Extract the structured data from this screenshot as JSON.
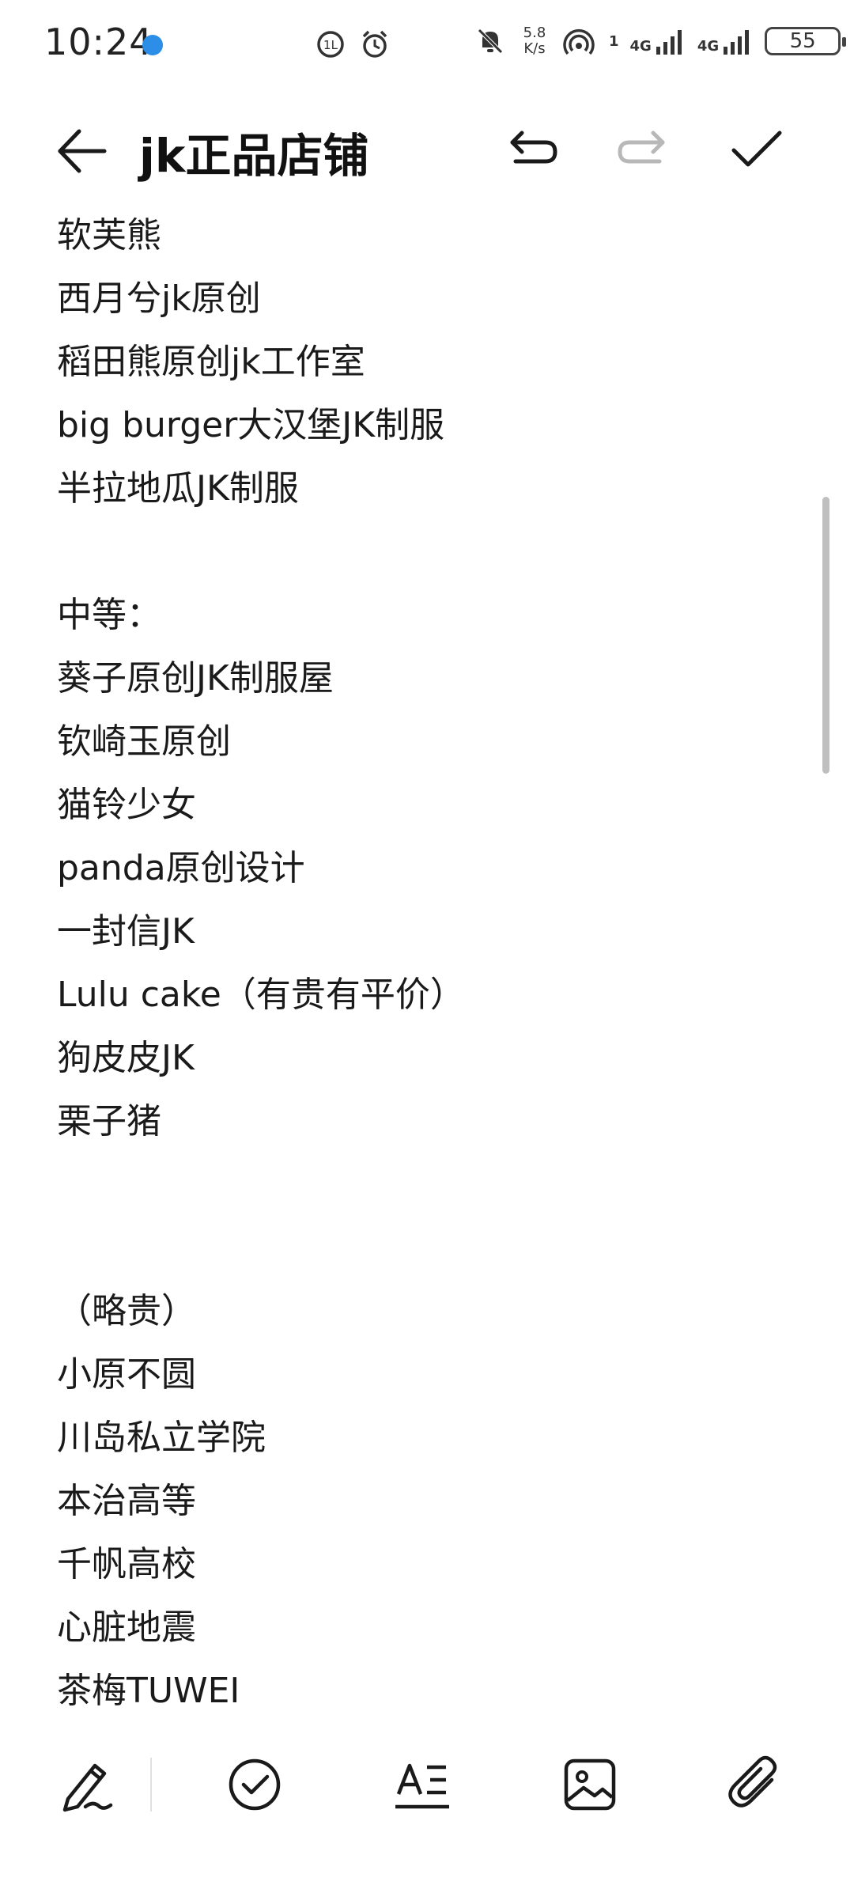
{
  "status_bar": {
    "time": "10:24",
    "net_speed_value": "5.8",
    "net_speed_unit": "K/s",
    "net_superscript": "1",
    "signal1_label": "4G",
    "signal2_label": "4G",
    "battery": "55"
  },
  "toolbar": {
    "title": "jk正品店铺"
  },
  "note": {
    "lines": [
      "软芙熊",
      "西月兮jk原创",
      "稻田熊原创jk工作室",
      "big burger大汉堡JK制服",
      "半拉地瓜JK制服",
      "",
      "中等：",
      "葵子原创JK制服屋",
      "钦崎玉原创",
      "猫铃少女",
      "panda原创设计",
      "一封信JK",
      "Lulu cake（有贵有平价）",
      "狗皮皮JK",
      "栗子猪",
      "",
      "",
      "（略贵）",
      "小原不圆",
      "川岛私立学院",
      "本治高等",
      "千帆高校",
      "心脏地震",
      "茶梅TUWEI"
    ]
  },
  "colors": {
    "icon": "#1a1a1a",
    "icon_disabled": "#b8b8b8",
    "scrollbar": "#bfbfbf",
    "status_dot": "#2d8ee8"
  }
}
